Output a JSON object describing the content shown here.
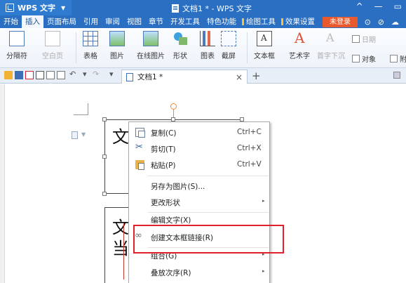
{
  "titlebar": {
    "app_name": "WPS 文字",
    "doc_title": "文档1 * - WPS 文字",
    "controls": [
      "^",
      "—",
      "▭"
    ]
  },
  "menubar": {
    "items": [
      {
        "label": "开始"
      },
      {
        "label": "插入",
        "active": true
      },
      {
        "label": "页面布局"
      },
      {
        "label": "引用"
      },
      {
        "label": "审阅"
      },
      {
        "label": "视图"
      },
      {
        "label": "章节"
      },
      {
        "label": "开发工具"
      },
      {
        "label": "特色功能"
      },
      {
        "label": "绘图工具",
        "special": true
      },
      {
        "label": "效果设置",
        "special": true
      }
    ],
    "login_label": "未登录",
    "right_icons": [
      "⊙",
      "⊘",
      "☁"
    ]
  },
  "ribbon": {
    "page_break": "分隔符",
    "blank_page": "空白页",
    "table": "表格",
    "picture": "图片",
    "online_picture": "在线图片",
    "shape": "形状",
    "chart": "图表",
    "screenshot": "截屏",
    "textbox": "文本框",
    "wordart": "艺术字",
    "dropcap": "首字下沉",
    "date": "日期",
    "object": "对象",
    "attachment": "附"
  },
  "tabbar": {
    "doc_tab_label": "文档1 *",
    "close": "×",
    "add": "+"
  },
  "document": {
    "textbox1_char": "文",
    "textbox2_chars": [
      "文",
      "当"
    ]
  },
  "context_menu": {
    "items": [
      {
        "label": "复制(C)",
        "shortcut": "Ctrl+C",
        "icon": "copy-icon"
      },
      {
        "label": "剪切(T)",
        "shortcut": "Ctrl+X",
        "icon": "cut-icon"
      },
      {
        "label": "粘贴(P)",
        "shortcut": "Ctrl+V",
        "icon": "paste-icon"
      },
      {
        "label": "另存为图片(S)..."
      },
      {
        "label": "更改形状",
        "submenu": true
      },
      {
        "label": "编辑文字(X)"
      },
      {
        "label": "创建文本框链接(R)",
        "icon": "link-icon"
      },
      {
        "label": "组合(G)",
        "submenu": true
      },
      {
        "label": "叠放次序(R)",
        "submenu": true
      }
    ],
    "submenu_arrow": "▸"
  },
  "colors": {
    "titlebar_blue": "#2a6fc2",
    "login_orange": "#e8592e",
    "highlight_red": "#e0212b",
    "rotation_handle": "#f08a2c"
  }
}
